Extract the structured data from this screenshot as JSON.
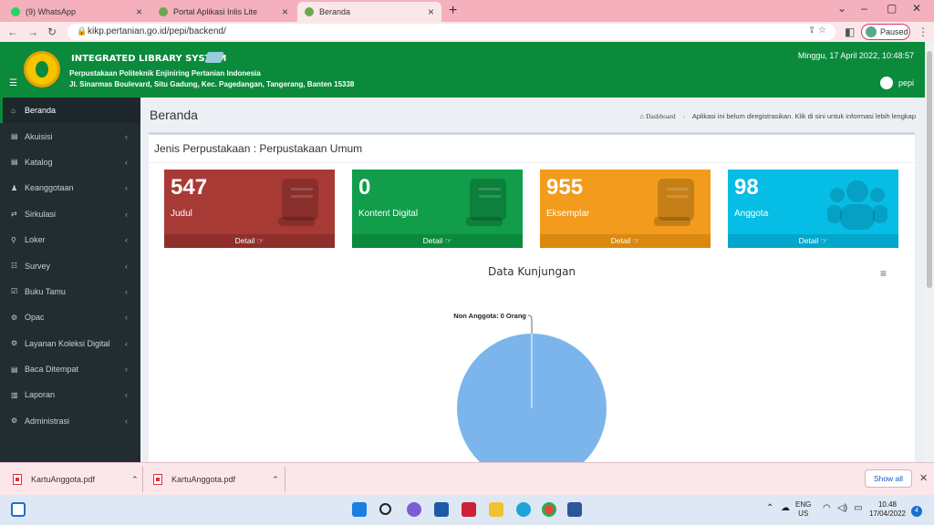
{
  "browser": {
    "tabs": [
      {
        "title": "(9) WhatsApp",
        "icon": "whatsapp-icon",
        "color": "#25d366"
      },
      {
        "title": "Portal Aplikasi Inlis Lite",
        "icon": "inlis-icon",
        "color": "#6aa84f"
      },
      {
        "title": "Beranda",
        "icon": "inlis-icon",
        "color": "#6aa84f"
      }
    ],
    "url": "kikp.pertanian.go.id/pepi/backend/",
    "profile_label": "Paused"
  },
  "header": {
    "system_title": "INTEGRATED LIBRARY SYSTEM",
    "institution": "Perpustakaan Politeknik Enjiniring Pertanian Indonesia",
    "address": "Jl. Sinarmas Boulevard, Situ Gadung, Kec. Pagedangan, Tangerang, Banten 15338",
    "datetime": "Minggu, 17 April 2022, 10:48:57",
    "username": "pepi"
  },
  "sidebar": {
    "items": [
      {
        "label": "Beranda",
        "active": true,
        "chevron": false
      },
      {
        "label": "Akuisisi",
        "chevron": true
      },
      {
        "label": "Katalog",
        "chevron": true
      },
      {
        "label": "Keanggotaan",
        "chevron": true
      },
      {
        "label": "Sirkulasi",
        "chevron": true
      },
      {
        "label": "Loker",
        "chevron": true
      },
      {
        "label": "Survey",
        "chevron": true
      },
      {
        "label": "Buku Tamu",
        "chevron": true
      },
      {
        "label": "Opac",
        "chevron": true
      },
      {
        "label": "Layanan Koleksi Digital",
        "chevron": true
      },
      {
        "label": "Baca Ditempat",
        "chevron": true
      },
      {
        "label": "Laporan",
        "chevron": true
      },
      {
        "label": "Administrasi",
        "chevron": true
      }
    ]
  },
  "page": {
    "title": "Beranda",
    "breadcrumb_home": "Dashboard",
    "registration_notice": "Aplikasi ini belum diregistrasikan. Klik di sini untuk informasi lebih lengkap",
    "box_title": "Jenis Perpustakaan : Perpustakaan Umum"
  },
  "cards": [
    {
      "value": "547",
      "label": "Judul",
      "detail": "Detail",
      "color": "#a73a35",
      "icon": "book-icon"
    },
    {
      "value": "0",
      "label": "Kontent Digital",
      "detail": "Detail",
      "color": "#119d4a",
      "icon": "book-icon"
    },
    {
      "value": "955",
      "label": "Eksemplar",
      "detail": "Detail",
      "color": "#f29b1d",
      "icon": "book-icon"
    },
    {
      "value": "98",
      "label": "Anggota",
      "detail": "Detail",
      "color": "#06bde5",
      "icon": "users-icon"
    }
  ],
  "chart_data": {
    "type": "pie",
    "title": "Data Kunjungan",
    "slices": [
      {
        "label": "Non Anggota: 0 Orang",
        "value": 0
      }
    ],
    "color": "#7cb5ec"
  },
  "downloads": [
    {
      "filename": "KartuAnggota.pdf"
    },
    {
      "filename": "KartuAnggota.pdf"
    }
  ],
  "download_bar": {
    "show_all": "Show all"
  },
  "taskbar": {
    "lang_line1": "ENG",
    "lang_line2": "US",
    "time": "10.48",
    "date": "17/04/2022",
    "notifications": "4"
  }
}
